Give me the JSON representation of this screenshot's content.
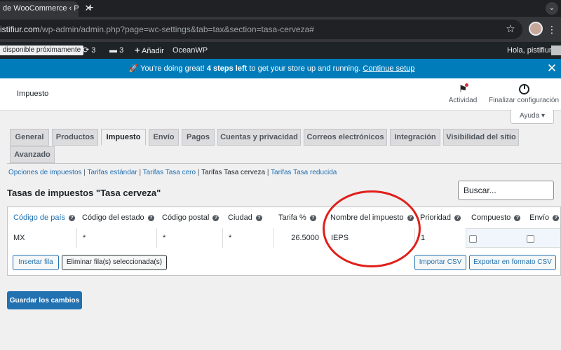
{
  "browser": {
    "tab_title": "de WooCommerce ‹ P",
    "url_host": "istifiur.com",
    "url_path": "/wp-admin/admin.php?page=wc-settings&tab=tax&section=tasa-cerveza#"
  },
  "adminbar": {
    "notice_label": "disponible próximamente",
    "updates_count": "3",
    "comments_count": "3",
    "add_label": "Añadir",
    "theme_label": "OceanWP",
    "greeting": "Hola, pistifiur"
  },
  "notice": {
    "emoji": "🚀",
    "lead": "You're doing great!",
    "bold": "4 steps left",
    "rest": "to get your store up and running.",
    "link": "Continue setup"
  },
  "header": {
    "title": "Impuesto",
    "activity_label": "Actividad",
    "finish_label": "Finalizar configuración",
    "help_label": "Ayuda ▾"
  },
  "tabs": [
    {
      "label": "General"
    },
    {
      "label": "Productos"
    },
    {
      "label": "Impuesto"
    },
    {
      "label": "Envío"
    },
    {
      "label": "Pagos"
    },
    {
      "label": "Cuentas y privacidad"
    },
    {
      "label": "Correos electrónicos"
    },
    {
      "label": "Integración"
    },
    {
      "label": "Visibilidad del sitio"
    },
    {
      "label": "Avanzado"
    }
  ],
  "subsub": {
    "items": [
      {
        "label": "Opciones de impuestos"
      },
      {
        "label": "Tarifas estándar"
      },
      {
        "label": "Tarifas Tasa cero"
      },
      {
        "label": "Tarifas Tasa cerveza"
      },
      {
        "label": "Tarifas Tasa reducida"
      }
    ],
    "separator": "|"
  },
  "section_title": "Tasas de impuestos \"Tasa cerveza\"",
  "search": {
    "placeholder": "Buscar..."
  },
  "table": {
    "headers": [
      "Código de país",
      "Código del estado",
      "Código postal",
      "Ciudad",
      "Tarifa %",
      "Nombre del impuesto",
      "Prioridad",
      "Compuesto",
      "Envío"
    ],
    "row": {
      "country": "MX",
      "state": "*",
      "postcode": "*",
      "city": "*",
      "rate": "26.5000",
      "name": "IEPS",
      "priority": "1"
    },
    "insert_label": "Insertar fila",
    "remove_label": "Eliminar fila(s) seleccionada(s)",
    "import_label": "Importar CSV",
    "export_label": "Exportar en formato CSV"
  },
  "save_label": "Guardar los cambios",
  "colors": {
    "accent": "#2271b1",
    "notice": "#007cba",
    "annotation": "#e0201b"
  }
}
